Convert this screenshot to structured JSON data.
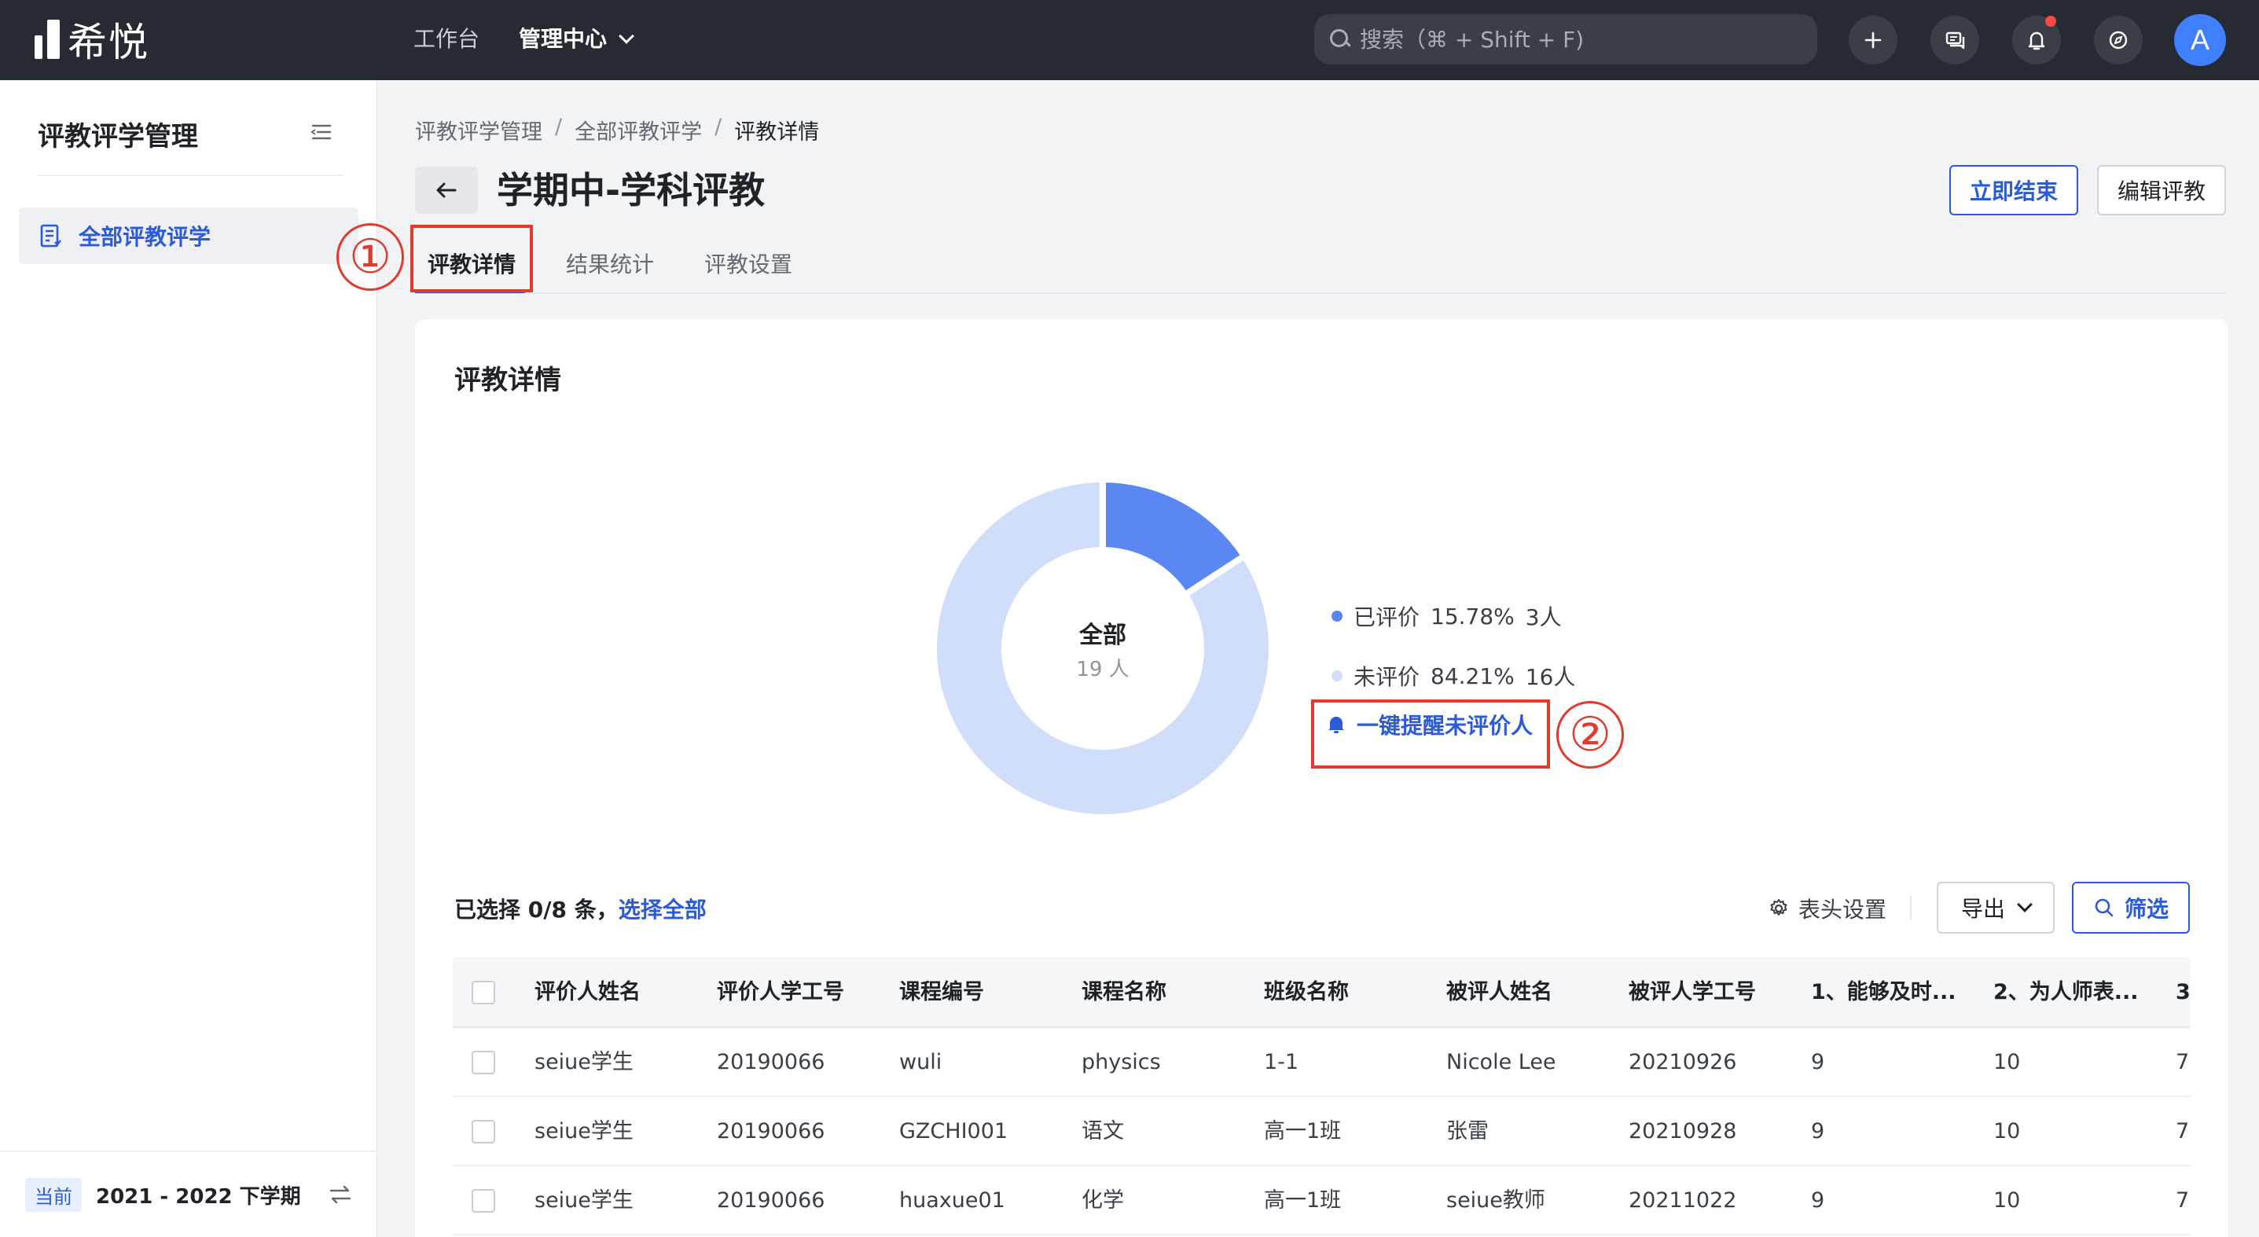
{
  "topbar": {
    "logo_text": "希悦",
    "nav": [
      {
        "label": "工作台"
      },
      {
        "label": "管理中心"
      }
    ],
    "search_placeholder": "搜索（⌘ + Shift + F)",
    "avatar_letter": "A"
  },
  "sidebar": {
    "title": "评教评学管理",
    "items": [
      {
        "label": "全部评教评学"
      }
    ],
    "footer": {
      "badge": "当前",
      "term": "2021 - 2022 下学期"
    }
  },
  "breadcrumb": [
    "评教评学管理",
    "全部评教评学",
    "评教详情"
  ],
  "page": {
    "title": "学期中-学科评教",
    "end_button": "立即结束",
    "edit_button": "编辑评教"
  },
  "tabs": [
    {
      "label": "评教详情"
    },
    {
      "label": "结果统计"
    },
    {
      "label": "评教设置"
    }
  ],
  "annotations": [
    "①",
    "②"
  ],
  "card": {
    "title": "评教详情",
    "donut_center_label": "全部",
    "donut_center_count": "19 人",
    "legend": [
      {
        "label": "已评价",
        "percent": "15.78%",
        "count": "3人",
        "value": 3,
        "color": "#5b87f2"
      },
      {
        "label": "未评价",
        "percent": "84.21%",
        "count": "16人",
        "value": 16,
        "color": "#d1defa"
      }
    ],
    "remind_label": "一键提醒未评价人"
  },
  "table_toolbar": {
    "selected_text": "已选择 0/8 条，",
    "select_all": "选择全部",
    "column_setting": "表头设置",
    "export": "导出",
    "filter": "筛选"
  },
  "table": {
    "headers": [
      "评价人姓名",
      "评价人学工号",
      "课程编号",
      "课程名称",
      "班级名称",
      "被评人姓名",
      "被评人学工号",
      "1、能够及时...",
      "2、为人师表...",
      "3"
    ],
    "rows": [
      [
        "seiue学生",
        "20190066",
        "wuli",
        "physics",
        "1-1",
        "Nicole Lee",
        "20210926",
        "9",
        "10",
        "7"
      ],
      [
        "seiue学生",
        "20190066",
        "GZCHI001",
        "语文",
        "高一1班",
        "张雷",
        "20210928",
        "9",
        "10",
        "7"
      ],
      [
        "seiue学生",
        "20190066",
        "huaxue01",
        "化学",
        "高一1班",
        "seiue教师",
        "20211022",
        "9",
        "10",
        "7"
      ]
    ]
  }
}
